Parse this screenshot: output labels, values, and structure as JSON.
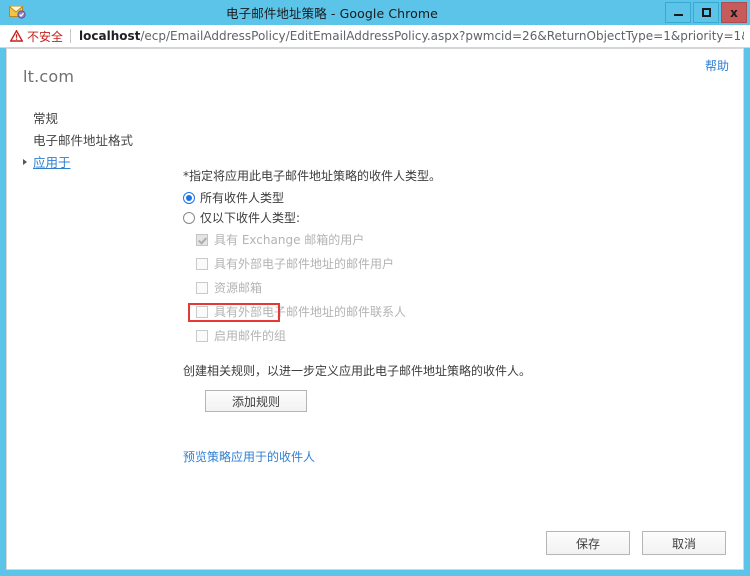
{
  "window": {
    "title": "电子邮件地址策略 - Google Chrome",
    "icon": "mail-policy-icon",
    "minimize_label": "",
    "maximize_label": "",
    "close_label": "x"
  },
  "omnibox": {
    "security_icon": "warning-triangle-icon",
    "security_label": "不安全",
    "url_host": "localhost",
    "url_path": "/ecp/EmailAddressPolicy/EditEmailAddressPolicy.aspx?pwmcid=26&ReturnObjectType=1&priority=1&id…"
  },
  "page": {
    "help_label": "帮助",
    "sidebar": {
      "title": "lt.com",
      "items": [
        {
          "label": "常规",
          "selected": false
        },
        {
          "label": "电子邮件地址格式",
          "selected": false
        },
        {
          "label": "应用于",
          "selected": true
        }
      ]
    },
    "form": {
      "instruction": "*指定将应用此电子邮件地址策略的收件人类型。",
      "radios": [
        {
          "label": "所有收件人类型",
          "checked": true
        },
        {
          "label": "仅以下收件人类型:",
          "checked": false
        }
      ],
      "checkboxes": [
        {
          "label": "具有 Exchange 邮箱的用户",
          "checked": true
        },
        {
          "label": "具有外部电子邮件地址的邮件用户",
          "checked": false
        },
        {
          "label": "资源邮箱",
          "checked": false
        },
        {
          "label": "具有外部电子邮件地址的邮件联系人",
          "checked": false
        },
        {
          "label": "启用邮件的组",
          "checked": false
        }
      ],
      "rules_text": "创建相关规则，以进一步定义应用此电子邮件地址策略的收件人。",
      "add_rule_label": "添加规则",
      "preview_link_label": "预览策略应用于的收件人"
    },
    "footer": {
      "save_label": "保存",
      "cancel_label": "取消"
    }
  },
  "annotation": {
    "highlight_color": "#e53935",
    "target": "所有收件人类型"
  }
}
